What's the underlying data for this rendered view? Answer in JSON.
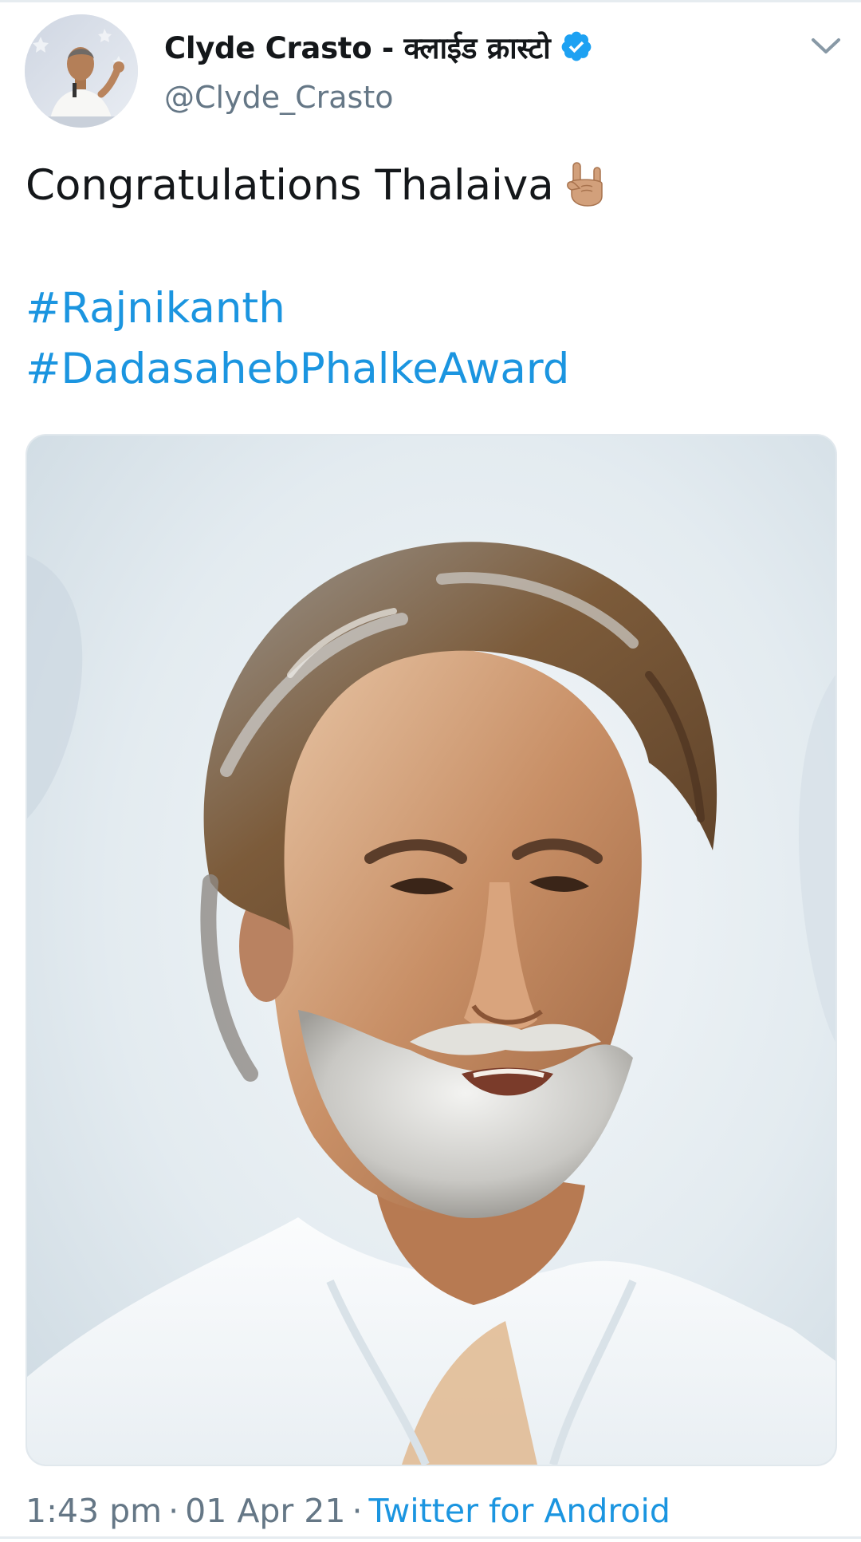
{
  "tweet": {
    "author": {
      "display_name": "Clyde Crasto - क्लाईड क्रास्टो",
      "handle": "@Clyde_Crasto",
      "verified": true,
      "avatar_icon": "profile-photo-man-speaking"
    },
    "text": "Congratulations Thalaiva",
    "emoji": "sign-of-the-horns-medium-skin-tone",
    "hashtags": [
      "#Rajnikanth",
      "#DadasahebPhalkeAward"
    ],
    "media": {
      "type": "image",
      "subject": "painted-portrait-grey-haired-bearded-man"
    },
    "time": "1:43 pm",
    "date": "01 Apr 21",
    "source": "Twitter for Android",
    "separator": "·"
  },
  "colors": {
    "link": "#1b95e0",
    "secondary_text": "#657786",
    "primary_text": "#14171a",
    "verified_badge": "#1da1f2",
    "divider": "#e6ecf0"
  },
  "icons": {
    "verified": "verified-badge-icon",
    "menu": "chevron-down-icon"
  }
}
